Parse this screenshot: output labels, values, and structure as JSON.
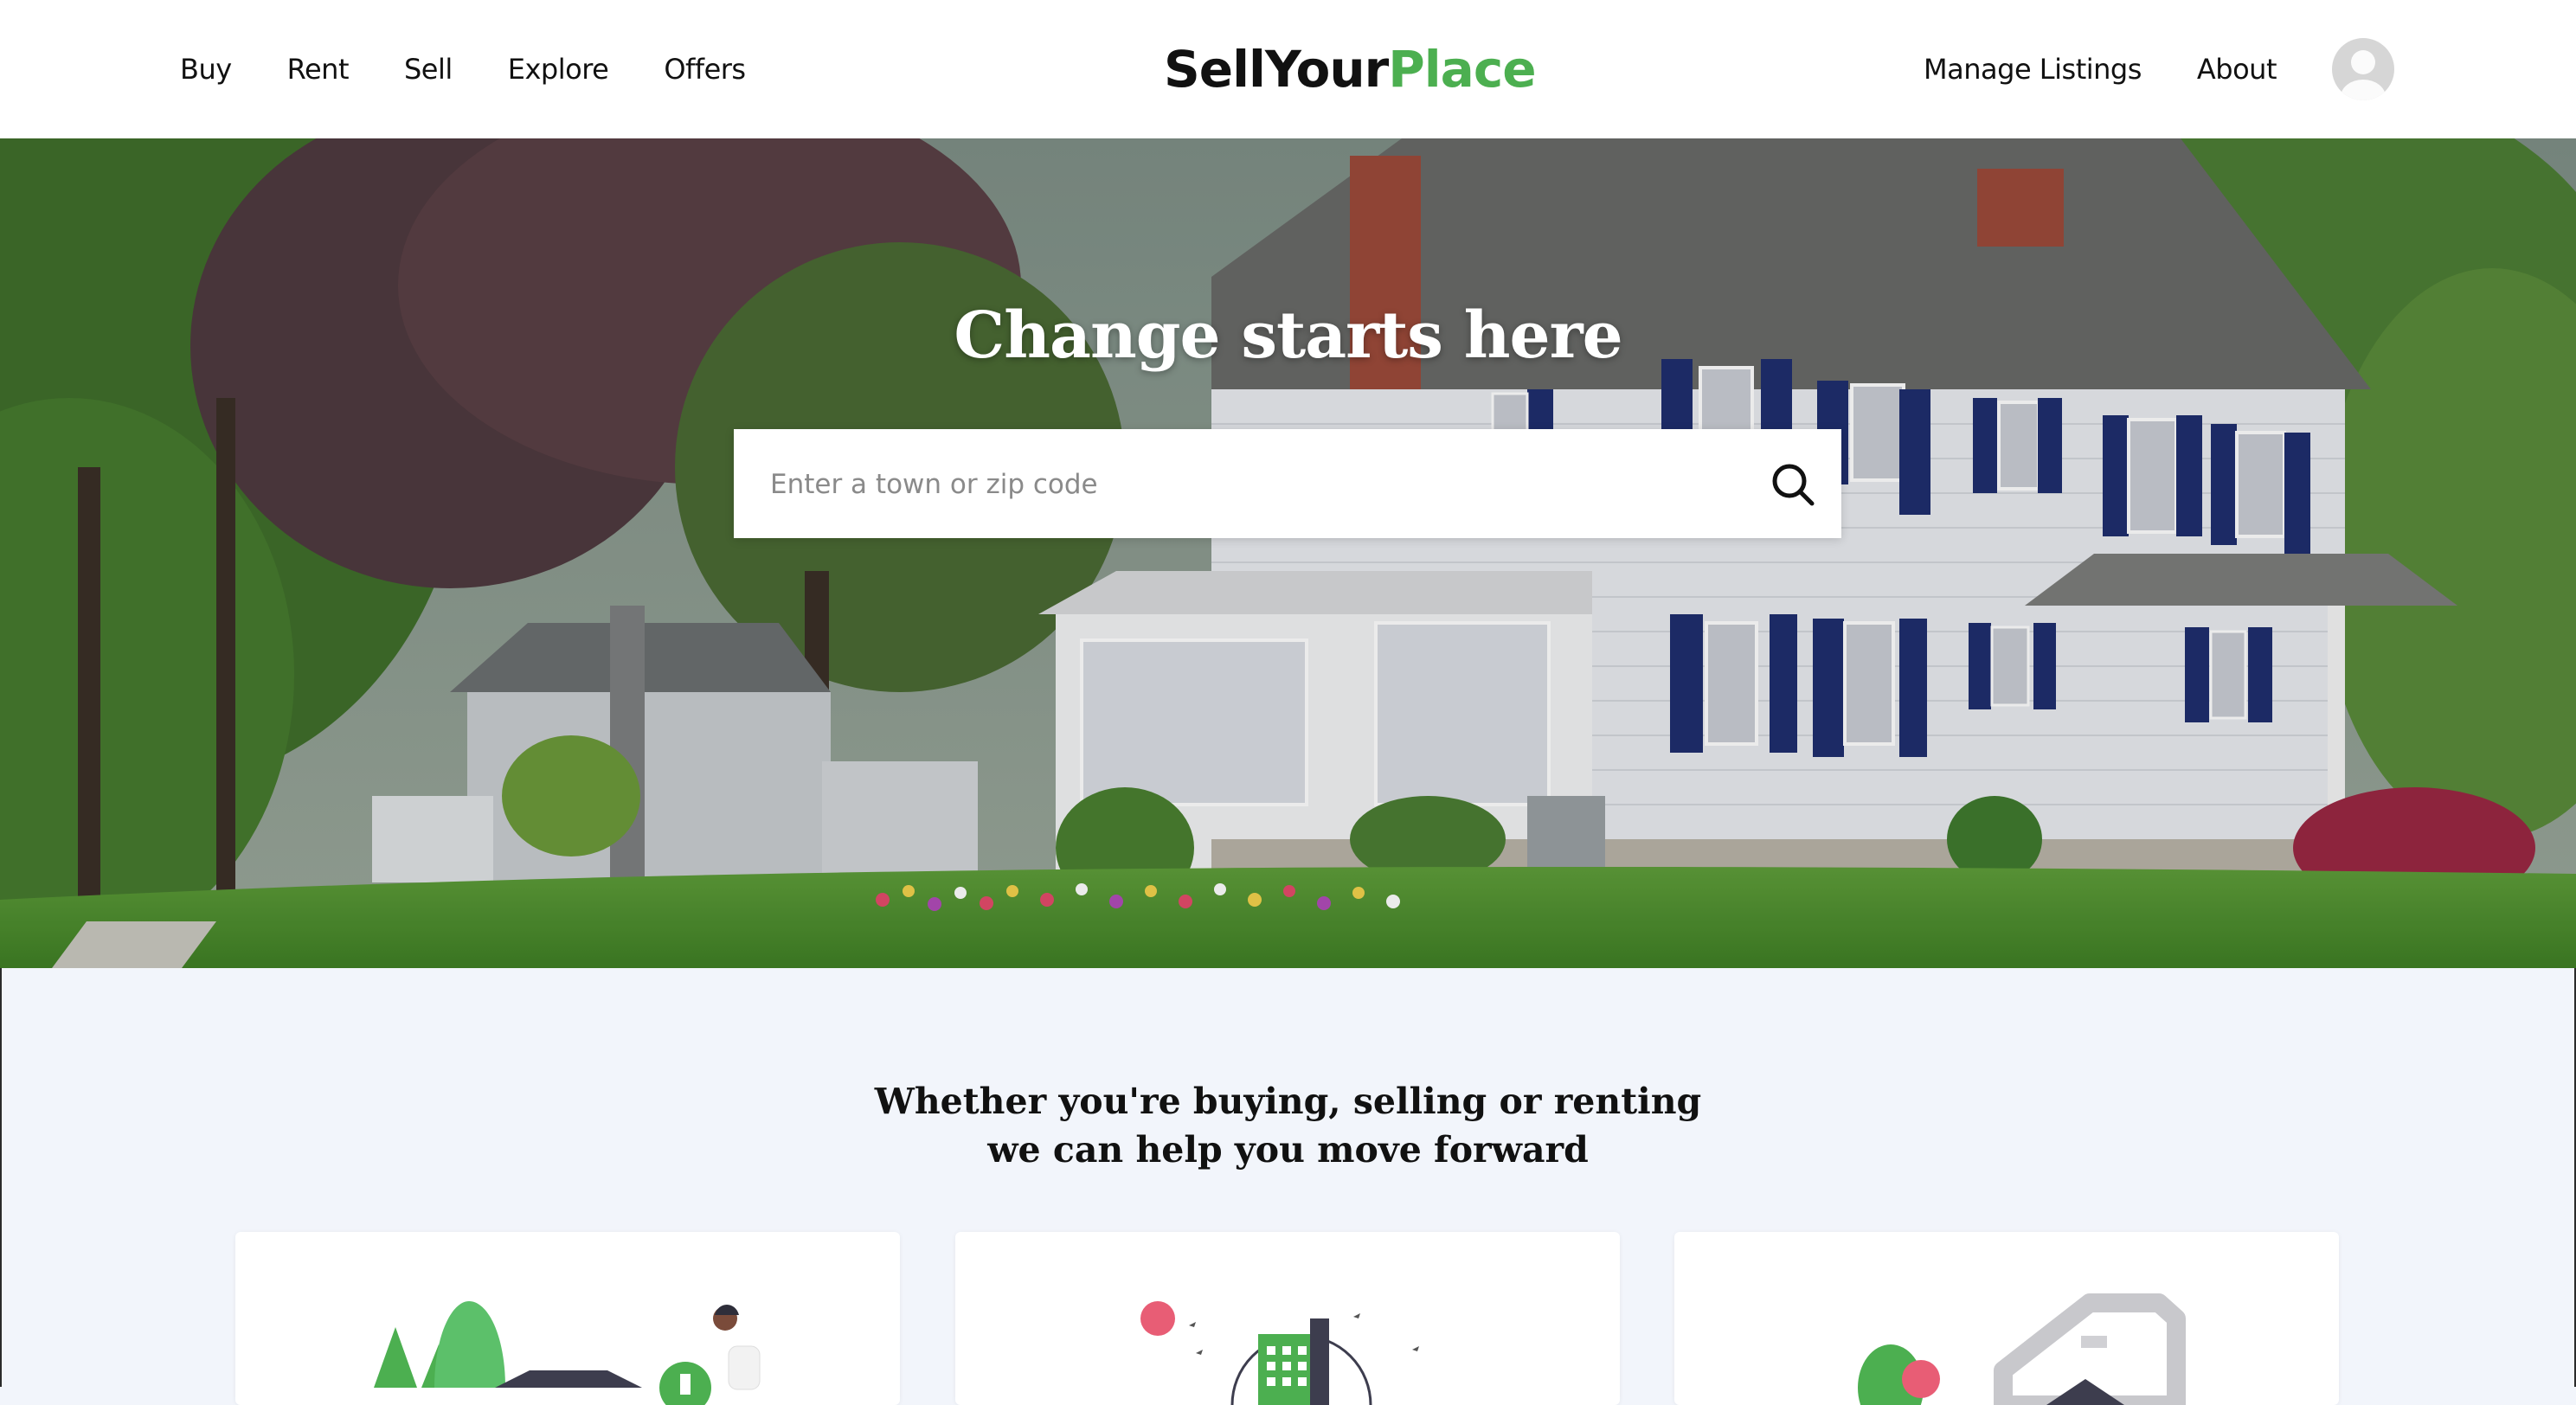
{
  "nav": {
    "left": [
      "Buy",
      "Rent",
      "Sell",
      "Explore",
      "Offers"
    ],
    "right": [
      "Manage Listings",
      "About"
    ]
  },
  "brand": {
    "part1": "SellYour",
    "part2": "Place",
    "accent": "#4caf50"
  },
  "hero": {
    "title": "Change starts here",
    "search_placeholder": "Enter a town or zip code",
    "search_icon": "search-icon"
  },
  "tagline": {
    "line1": "Whether you're buying, selling or renting",
    "line2": "we can help you move forward"
  },
  "cards": [
    {
      "illustration": "buy-home-illustration"
    },
    {
      "illustration": "rent-building-illustration"
    },
    {
      "illustration": "sell-house-illustration"
    }
  ],
  "colors": {
    "primary": "#4caf50",
    "page_bg": "#f2f5fb",
    "accent_red": "#e85d75",
    "dark": "#3d3d4e"
  }
}
